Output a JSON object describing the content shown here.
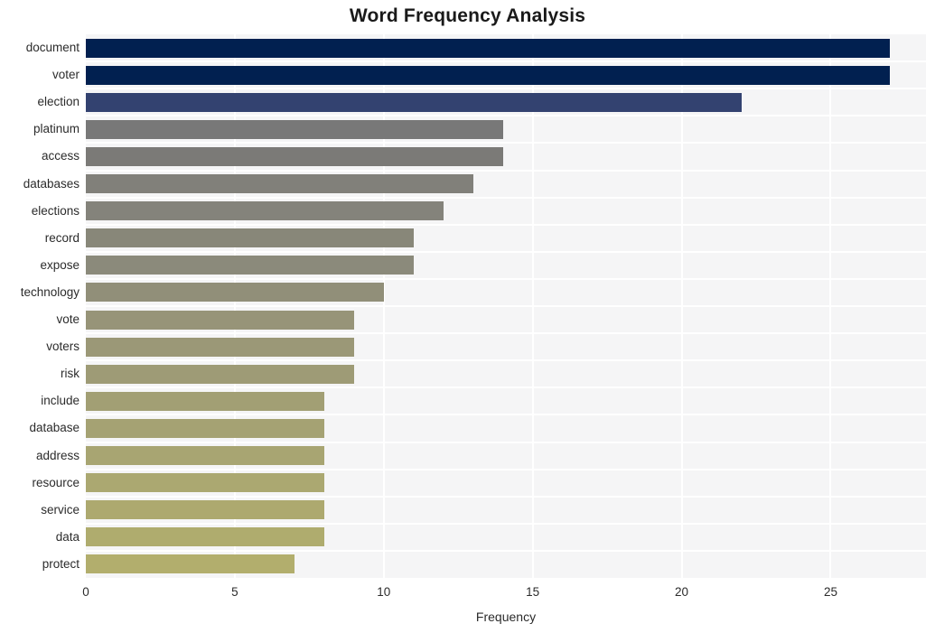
{
  "chart_data": {
    "type": "bar",
    "orientation": "horizontal",
    "title": "Word Frequency Analysis",
    "xlabel": "Frequency",
    "ylabel": "",
    "categories": [
      "document",
      "voter",
      "election",
      "platinum",
      "access",
      "databases",
      "elections",
      "record",
      "expose",
      "technology",
      "vote",
      "voters",
      "risk",
      "include",
      "database",
      "address",
      "resource",
      "service",
      "data",
      "protect"
    ],
    "values": [
      27,
      27,
      22,
      14,
      14,
      13,
      12,
      11,
      11,
      10,
      9,
      9,
      9,
      8,
      8,
      8,
      8,
      8,
      8,
      7
    ],
    "bar_colors": [
      "#012050",
      "#012050",
      "#334270",
      "#787878",
      "#7b7a77",
      "#81807a",
      "#84837b",
      "#888779",
      "#8b8a7b",
      "#918f79",
      "#979478",
      "#9b9877",
      "#9e9b76",
      "#a29f74",
      "#a5a273",
      "#a8a572",
      "#aba871",
      "#ada96f",
      "#afac6e",
      "#b2ae6d"
    ],
    "xlim": [
      0,
      28.2
    ],
    "xticks": [
      0,
      5,
      10,
      15,
      20,
      25
    ],
    "xtick_labels": [
      "0",
      "5",
      "10",
      "15",
      "20",
      "25"
    ],
    "grid": true,
    "grid_color": "#ffffff",
    "plot_background": "#f5f5f6",
    "figure_background": "#ffffff",
    "legend": null,
    "palette": "navy-to-khaki sequential"
  }
}
